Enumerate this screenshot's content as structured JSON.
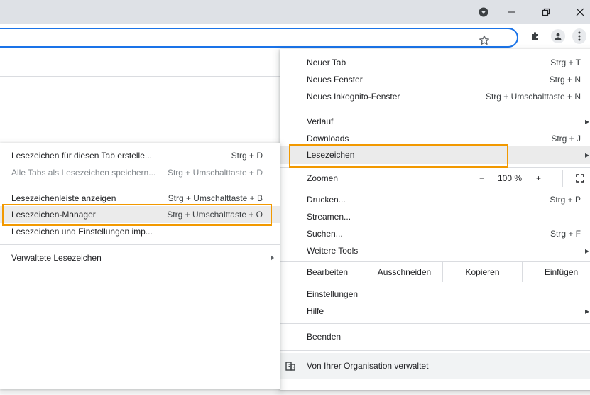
{
  "colors": {
    "accent": "#1a73e8",
    "callout": "#f29900",
    "titlebar": "#dee1e6",
    "highlight": "#ebebeb"
  },
  "main_menu": {
    "new_tab": {
      "label": "Neuer Tab",
      "shortcut": "Strg + T"
    },
    "new_window": {
      "label": "Neues Fenster",
      "shortcut": "Strg + N"
    },
    "incognito": {
      "label": "Neues Inkognito-Fenster",
      "shortcut": "Strg + Umschalttaste + N"
    },
    "history": {
      "label": "Verlauf"
    },
    "downloads": {
      "label": "Downloads",
      "shortcut": "Strg + J"
    },
    "bookmarks": {
      "label": "Lesezeichen"
    },
    "zoom": {
      "label": "Zoomen",
      "minus": "−",
      "value": "100 %",
      "plus": "+"
    },
    "print": {
      "label": "Drucken...",
      "shortcut": "Strg + P"
    },
    "cast": {
      "label": "Streamen..."
    },
    "find": {
      "label": "Suchen...",
      "shortcut": "Strg + F"
    },
    "more_tools": {
      "label": "Weitere Tools"
    },
    "edit": {
      "label": "Bearbeiten",
      "cut": "Ausschneiden",
      "copy": "Kopieren",
      "paste": "Einfügen"
    },
    "settings": {
      "label": "Einstellungen"
    },
    "help": {
      "label": "Hilfe"
    },
    "exit": {
      "label": "Beenden"
    },
    "managed": {
      "label": "Von Ihrer Organisation verwaltet"
    }
  },
  "sub_menu": {
    "bookmark_tab": {
      "label": "Lesezeichen für diesen Tab erstelle...",
      "shortcut": "Strg + D"
    },
    "bookmark_all": {
      "label": "Alle Tabs als Lesezeichen speichern...",
      "shortcut": "Strg + Umschalttaste + D"
    },
    "show_bar": {
      "label": "Lesezeichenleiste anzeigen",
      "shortcut": "Strg + Umschalttaste + B"
    },
    "manager": {
      "label": "Lesezeichen-Manager",
      "shortcut": "Strg + Umschalttaste + O"
    },
    "import": {
      "label": "Lesezeichen und Einstellungen imp..."
    },
    "managed_bookmarks": {
      "label": "Verwaltete Lesezeichen"
    }
  }
}
